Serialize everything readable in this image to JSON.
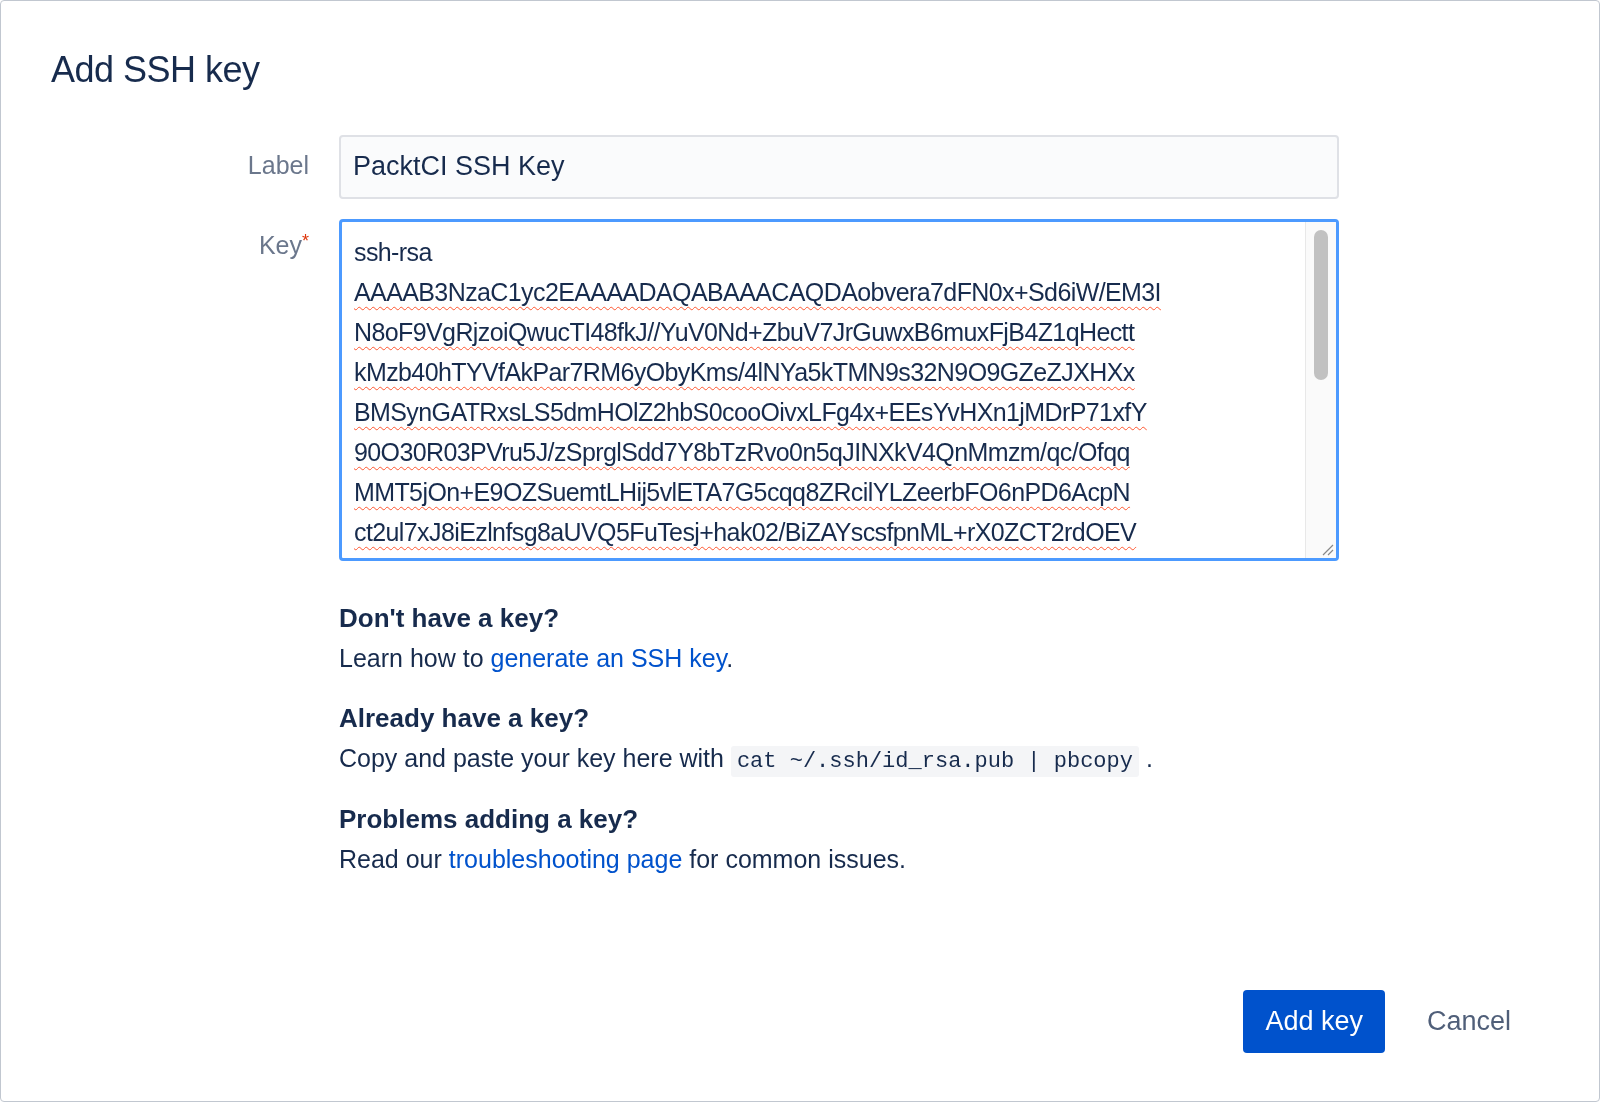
{
  "dialog": {
    "title": "Add SSH key"
  },
  "label_field": {
    "label": "Label",
    "value": "PacktCI SSH Key"
  },
  "key_field": {
    "label": "Key",
    "required_mark": "*",
    "focused": true,
    "lines": [
      "ssh-rsa",
      "AAAAB3NzaC1yc2EAAAADAQABAAACAQDAobvera7dFN0x+Sd6iW/EM3I",
      "N8oF9VgRjzoiQwucTI48fkJ//YuV0Nd+ZbuV7JrGuwxB6muxFjB4Z1qHectt",
      "kMzb40hTYVfAkPar7RM6yObyKms/4lNYa5kTMN9s32N9O9GZeZJXHXx",
      "BMSynGATRxsLS5dmHOlZ2hbS0cooOivxLFg4x+EEsYvHXn1jMDrP71xfY",
      "90O30R03PVru5J/zSprglSdd7Y8bTzRvo0n5qJINXkV4QnMmzm/qc/Ofqq",
      "MMT5jOn+E9OZSuemtLHij5vlETA7G5cqq8ZRcilYLZeerbFO6nPD6AcpN",
      "ct2ul7xJ8iEzlnfsg8aUVQ5FuTesj+hak02/BiZAYscsfpnML+rX0ZCT2rdOEV"
    ]
  },
  "help": [
    {
      "heading": "Don't have a key?",
      "parts": [
        {
          "kind": "text",
          "text": "Learn how to "
        },
        {
          "kind": "link",
          "text": "generate an SSH key"
        },
        {
          "kind": "text",
          "text": "."
        }
      ]
    },
    {
      "heading": "Already have a key?",
      "parts": [
        {
          "kind": "text",
          "text": "Copy and paste your key here with "
        },
        {
          "kind": "code",
          "text": "cat ~/.ssh/id_rsa.pub | pbcopy"
        },
        {
          "kind": "text",
          "text": " ."
        }
      ]
    },
    {
      "heading": "Problems adding a key?",
      "parts": [
        {
          "kind": "text",
          "text": "Read our "
        },
        {
          "kind": "link",
          "text": "troubleshooting page"
        },
        {
          "kind": "text",
          "text": " for common issues."
        }
      ]
    }
  ],
  "buttons": [
    {
      "kind": "primary",
      "label": "Add key"
    },
    {
      "kind": "subtle",
      "label": "Cancel"
    }
  ]
}
